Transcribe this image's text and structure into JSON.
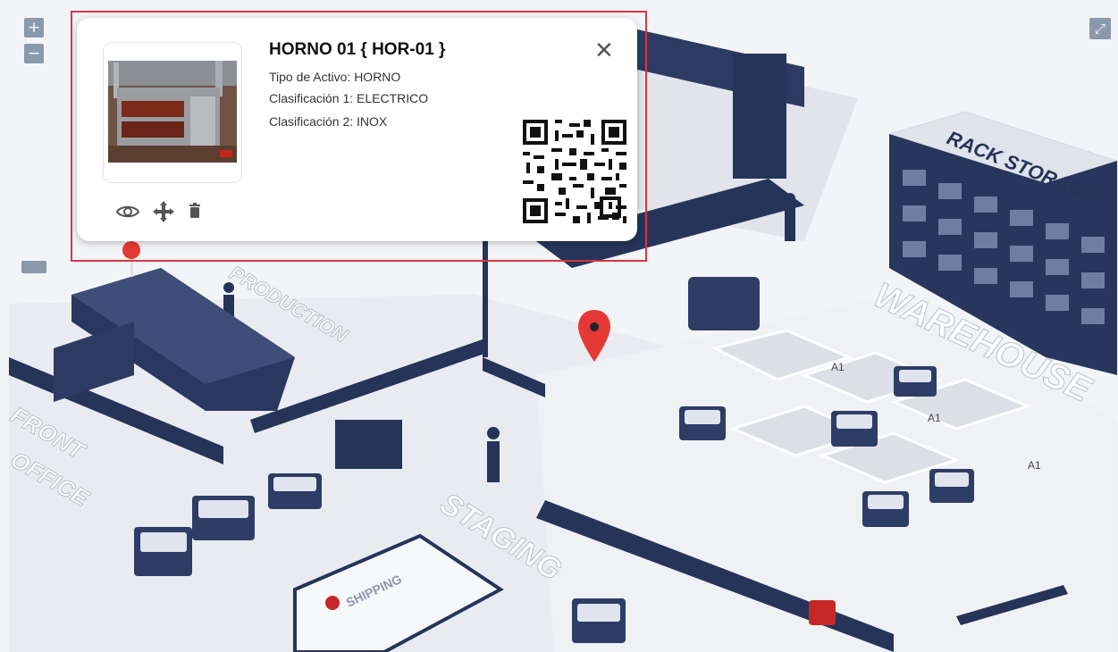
{
  "map": {
    "zoom_in_label": "+",
    "zoom_out_label": "−",
    "fullscreen_label": "⤢",
    "labels": [
      "RACK STORAGE",
      "WAREHOUSE",
      "STAGING",
      "PRODUCTION",
      "FRONT OFFICE",
      "SHIPPING",
      "A1",
      "A1",
      "A1"
    ]
  },
  "popup": {
    "title": "HORNO 01 { HOR-01 }",
    "tipo": "Tipo de Activo: HORNO",
    "clas1": "Clasificación 1: ELECTRICO",
    "clas2": "Clasificación 2: INOX",
    "close_label": "✕",
    "actions": [
      "eye-icon",
      "move-icon",
      "trash-icon"
    ]
  },
  "colors": {
    "accent": "#d9363e",
    "navy": "#26345a",
    "marker": "#e53935",
    "control": "#8b99ad"
  }
}
